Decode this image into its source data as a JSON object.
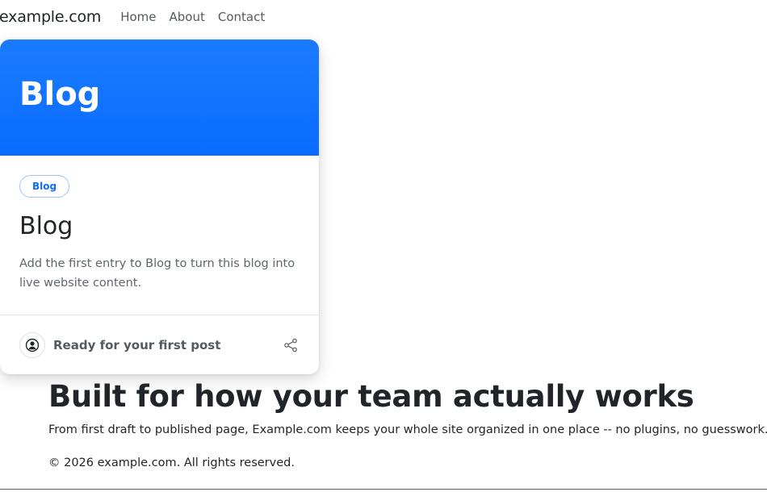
{
  "nav": {
    "brand": "example.com",
    "links": [
      {
        "label": "Home"
      },
      {
        "label": "About"
      },
      {
        "label": "Contact"
      }
    ]
  },
  "card": {
    "hero_title": "Blog",
    "tag": "Blog",
    "title": "Blog",
    "text": "Add the first entry to Blog to turn this blog into live website content.",
    "footer": {
      "avatar_icon": "user-circle-icon",
      "label": "Ready for your first post",
      "share_icon": "share-icon"
    },
    "hero_color": "#0d6efd"
  },
  "section": {
    "headline": "Built for how your team actually works",
    "subline": "From first draft to published page, Example.com keeps your whole site organized in one place -- no plugins, no guesswork."
  },
  "footer": {
    "copyright": "© 2026 example.com. All rights reserved."
  }
}
